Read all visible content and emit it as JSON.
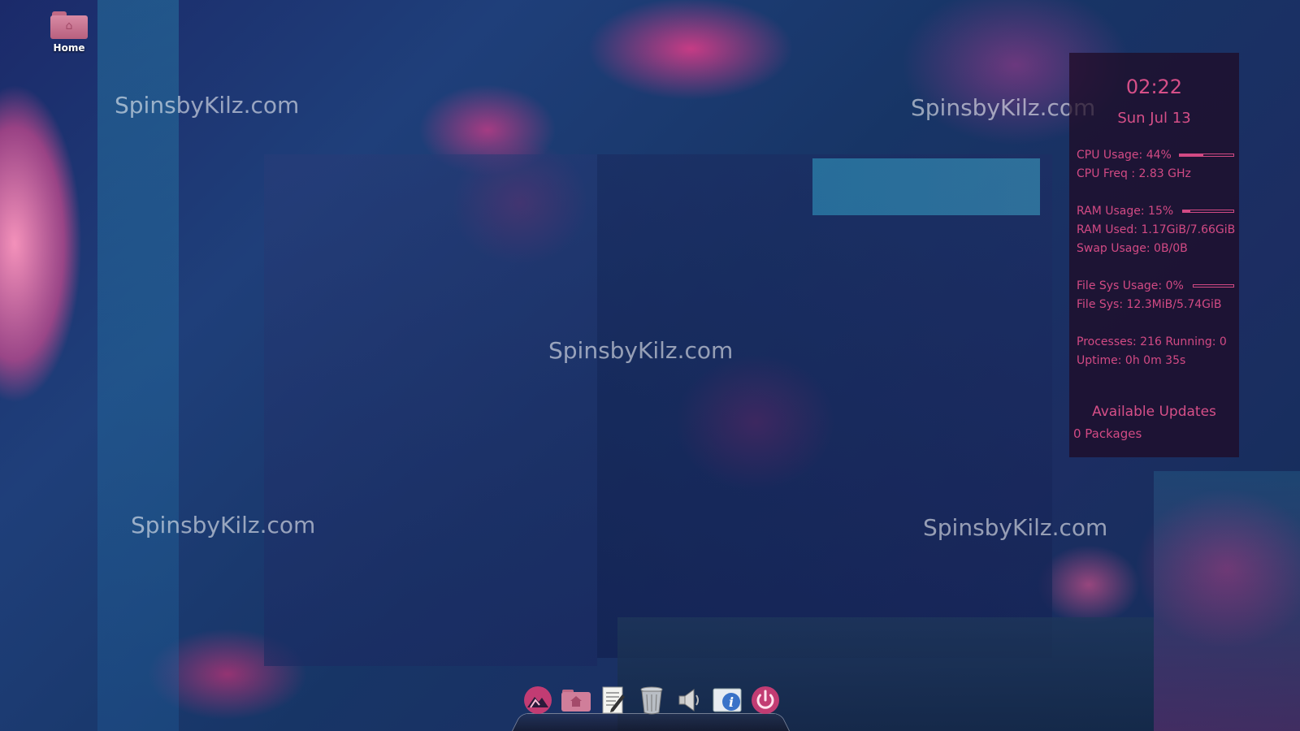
{
  "desktop": {
    "icons": [
      {
        "label": "Home"
      }
    ],
    "watermark_text": "SpinsbyKilz.com"
  },
  "conky": {
    "time": "02:22",
    "date": "Sun Jul 13",
    "cpu_usage_label": "CPU Usage: 44%",
    "cpu_usage_percent": 44,
    "cpu_freq": "CPU Freq : 2.83 GHz",
    "ram_usage_label": "RAM Usage: 15%",
    "ram_usage_percent": 15,
    "ram_used": "RAM Used: 1.17GiB/7.66GiB",
    "swap_usage": "Swap Usage: 0B/0B",
    "fs_usage_label": "File Sys Usage:  0%",
    "fs_usage_percent": 0,
    "fs_sys": "File Sys: 12.3MiB/5.74GiB",
    "processes": "Processes: 216   Running: 0",
    "uptime": "Uptime: 0h 0m 35s",
    "updates_title": "Available Updates",
    "updates_count": "0 Packages",
    "accent_color": "#d24a84"
  },
  "dock": {
    "items": [
      {
        "icon": "mountain-logo-icon"
      },
      {
        "icon": "home-folder-icon"
      },
      {
        "icon": "text-editor-icon"
      },
      {
        "icon": "trash-icon"
      },
      {
        "icon": "volume-icon"
      },
      {
        "icon": "info-icon"
      },
      {
        "icon": "power-icon"
      }
    ]
  }
}
